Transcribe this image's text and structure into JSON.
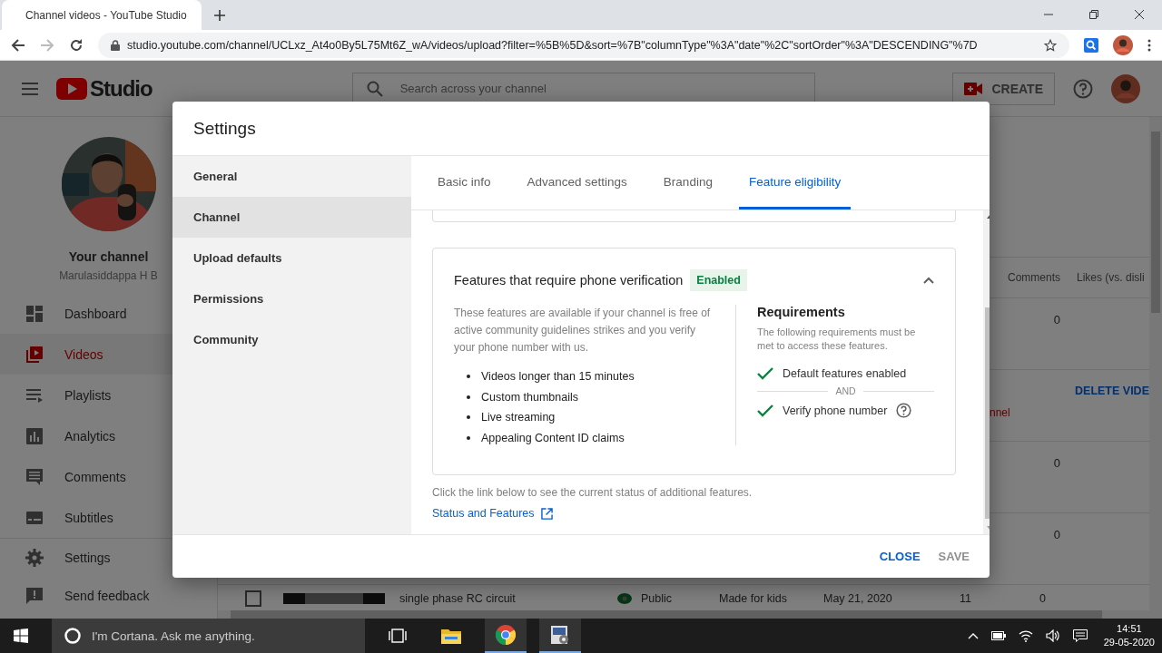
{
  "browser": {
    "tab_title": "Channel videos - YouTube Studio",
    "url": "studio.youtube.com/channel/UCLxz_At4o0By5L75Mt6Z_wA/videos/upload?filter=%5B%5D&sort=%7B\"columnType\"%3A\"date\"%2C\"sortOrder\"%3A\"DESCENDING\"%7D"
  },
  "studio_header": {
    "logo_text": "Studio",
    "search": {
      "placeholder": "Search across your channel"
    },
    "create_label": "CREATE"
  },
  "sidebar": {
    "channel_title": "Your channel",
    "channel_name": "Marulasiddappa H B",
    "items": [
      {
        "kind": "dashboard",
        "label": "Dashboard",
        "selected": false
      },
      {
        "kind": "videos",
        "label": "Videos",
        "selected": true
      },
      {
        "kind": "playlists",
        "label": "Playlists",
        "selected": false
      },
      {
        "kind": "analytics",
        "label": "Analytics",
        "selected": false
      },
      {
        "kind": "comments",
        "label": "Comments",
        "selected": false
      },
      {
        "kind": "subtitles",
        "label": "Subtitles",
        "selected": false
      }
    ],
    "bottom_items": [
      {
        "kind": "settings",
        "label": "Settings",
        "selected": false
      },
      {
        "kind": "feedback",
        "label": "Send feedback",
        "selected": false
      }
    ]
  },
  "videos_table": {
    "columns": [
      "Comments",
      "Likes (vs. disli"
    ],
    "rows": [
      {
        "kind": "value",
        "comments": "0"
      },
      {
        "kind": "action",
        "action": "DELETE VIDE",
        "note": "nnel"
      },
      {
        "kind": "value",
        "comments": "0"
      },
      {
        "kind": "value",
        "comments": "0"
      }
    ],
    "last_row": {
      "checked": false,
      "title": "single phase RC circuit",
      "visibility": "Public",
      "restrictions": "Made for kids",
      "date": "May 21, 2020",
      "views": "11",
      "comments": "0"
    }
  },
  "settings_dialog": {
    "title": "Settings",
    "nav": [
      {
        "label": "General",
        "selected": false
      },
      {
        "label": "Channel",
        "selected": true
      },
      {
        "label": "Upload defaults",
        "selected": false
      },
      {
        "label": "Permissions",
        "selected": false
      },
      {
        "label": "Community",
        "selected": false
      }
    ],
    "tabs": [
      {
        "label": "Basic info",
        "selected": false
      },
      {
        "label": "Advanced settings",
        "selected": false
      },
      {
        "label": "Branding",
        "selected": false
      },
      {
        "label": "Feature eligibility",
        "selected": true
      }
    ],
    "feature_card": {
      "title": "Features that require phone verification",
      "badge": "Enabled",
      "expanded": true,
      "description": "These features are available if your channel is free of active community guidelines strikes and you verify your phone number with us.",
      "features": [
        "Videos longer than 15 minutes",
        "Custom thumbnails",
        "Live streaming",
        "Appealing Content ID claims"
      ],
      "requirements_title": "Requirements",
      "requirements_subtitle": "The following requirements must be met to access these features.",
      "requirements": [
        {
          "label": "Default features enabled",
          "met": true,
          "help": false
        },
        {
          "label": "Verify phone number",
          "met": true,
          "help": true
        }
      ],
      "separator": "AND"
    },
    "footnote": "Click the link below to see the current status of additional features.",
    "link": "Status and Features",
    "buttons": [
      {
        "label": "CLOSE",
        "disabled": false
      },
      {
        "label": "SAVE",
        "disabled": true
      }
    ]
  },
  "taskbar": {
    "search_placeholder": "I'm Cortana. Ask me anything.",
    "time": "14:51",
    "date": "29-05-2020"
  }
}
